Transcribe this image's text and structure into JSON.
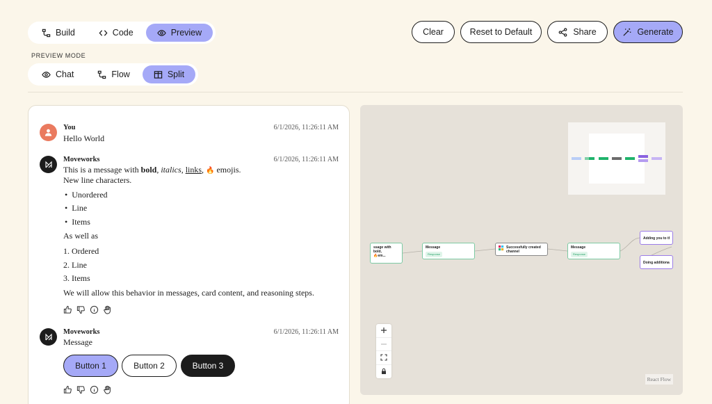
{
  "header": {
    "view_tabs": [
      {
        "label": "Build",
        "icon": "flow-icon"
      },
      {
        "label": "Code",
        "icon": "code-icon"
      },
      {
        "label": "Preview",
        "icon": "eye-icon",
        "active": true
      }
    ],
    "preview_mode_label": "PREVIEW MODE",
    "mode_tabs": [
      {
        "label": "Chat",
        "icon": "eye-icon"
      },
      {
        "label": "Flow",
        "icon": "flow-icon"
      },
      {
        "label": "Split",
        "icon": "split-icon",
        "active": true
      }
    ],
    "actions": {
      "clear": "Clear",
      "reset": "Reset to Default",
      "share": "Share",
      "generate": "Generate"
    }
  },
  "chat": {
    "messages": [
      {
        "sender": "You",
        "timestamp": "6/1/2026, 11:26:11 AM",
        "text": "Hello World"
      },
      {
        "sender": "Moveworks",
        "timestamp": "6/1/2026, 11:26:11 AM",
        "line1_prefix": "This is a message with ",
        "bold": "bold",
        "sep1": ", ",
        "italic": "italics",
        "sep2": ", ",
        "link": "links",
        "sep3": ", ",
        "emoji": "🔥",
        "line1_suffix": " emojis.",
        "line2": "New line characters.",
        "unordered": [
          "Unordered",
          "Line",
          "Items"
        ],
        "as_well": "As well as",
        "ordered": [
          "1. Ordered",
          "2. Line",
          "3. Items"
        ],
        "closing": "We will allow this behavior in messages, card content, and reasoning steps."
      },
      {
        "sender": "Moveworks",
        "timestamp": "6/1/2026, 11:26:11 AM",
        "text": "Message",
        "buttons": [
          "Button 1",
          "Button 2",
          "Button 3"
        ]
      }
    ]
  },
  "flow": {
    "nodes": [
      {
        "title": "ssage with bold,",
        "subtitle": "🔥em..."
      },
      {
        "title": "Message",
        "tag": "Response"
      },
      {
        "title": "Successfully created channel"
      },
      {
        "title": "Message",
        "tag": "Response"
      },
      {
        "title": "Adding you to the li"
      },
      {
        "title": "Doing additional wo"
      }
    ],
    "attribution": "React Flow"
  },
  "colors": {
    "background": "#fbf6ea",
    "accent": "#a5a9f7",
    "user_avatar": "#ea7a5f",
    "dark": "#1c1c1c"
  }
}
